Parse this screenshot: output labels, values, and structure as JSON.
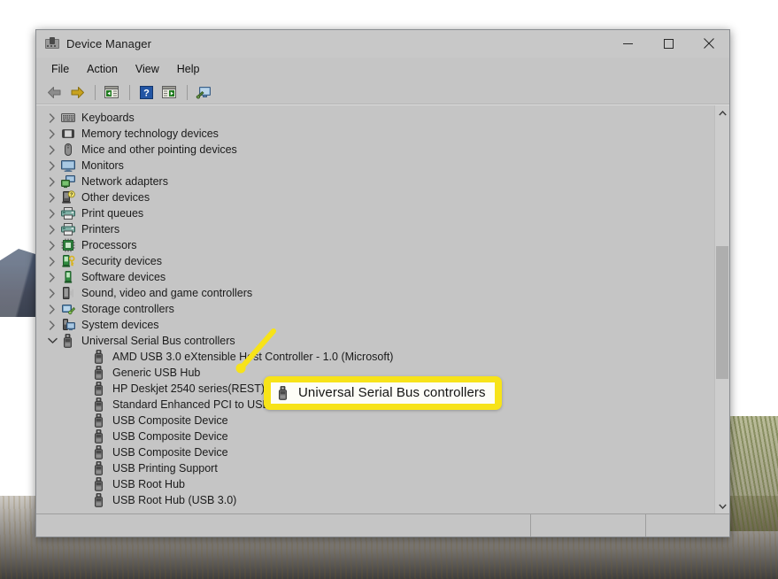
{
  "window": {
    "title": "Device Manager",
    "icon": "device-manager-icon",
    "controls": {
      "minimize": "minimize-button",
      "maximize": "maximize-button",
      "close": "close-button"
    }
  },
  "menubar": {
    "items": [
      {
        "label": "File"
      },
      {
        "label": "Action"
      },
      {
        "label": "View"
      },
      {
        "label": "Help"
      }
    ]
  },
  "toolbar": {
    "items": [
      {
        "name": "back-button",
        "icon": "back-arrow-icon"
      },
      {
        "name": "forward-button",
        "icon": "forward-arrow-icon"
      },
      {
        "name": "separator-1",
        "icon": "separator"
      },
      {
        "name": "show-hide-console-tree-button",
        "icon": "console-tree-icon"
      },
      {
        "name": "separator-2",
        "icon": "separator"
      },
      {
        "name": "help-button",
        "icon": "question-mark-icon"
      },
      {
        "name": "properties-button",
        "icon": "properties-window-icon"
      },
      {
        "name": "separator-3",
        "icon": "separator"
      },
      {
        "name": "scan-for-hardware-changes-button",
        "icon": "monitor-scan-icon"
      }
    ]
  },
  "tree": {
    "items": [
      {
        "label": "Keyboards",
        "icon": "keyboard-icon",
        "expanded": false,
        "level": 0
      },
      {
        "label": "Memory technology devices",
        "icon": "memory-icon",
        "expanded": false,
        "level": 0
      },
      {
        "label": "Mice and other pointing devices",
        "icon": "mouse-icon",
        "expanded": false,
        "level": 0
      },
      {
        "label": "Monitors",
        "icon": "monitor-icon",
        "expanded": false,
        "level": 0
      },
      {
        "label": "Network adapters",
        "icon": "network-adapter-icon",
        "expanded": false,
        "level": 0
      },
      {
        "label": "Other devices",
        "icon": "other-device-icon",
        "expanded": false,
        "level": 0
      },
      {
        "label": "Print queues",
        "icon": "printer-icon",
        "expanded": false,
        "level": 0
      },
      {
        "label": "Printers",
        "icon": "printer-icon",
        "expanded": false,
        "level": 0
      },
      {
        "label": "Processors",
        "icon": "processor-icon",
        "expanded": false,
        "level": 0
      },
      {
        "label": "Security devices",
        "icon": "security-device-icon",
        "expanded": false,
        "level": 0
      },
      {
        "label": "Software devices",
        "icon": "software-device-icon",
        "expanded": false,
        "level": 0
      },
      {
        "label": "Sound, video and game controllers",
        "icon": "sound-device-icon",
        "expanded": false,
        "level": 0
      },
      {
        "label": "Storage controllers",
        "icon": "storage-controller-icon",
        "expanded": false,
        "level": 0
      },
      {
        "label": "System devices",
        "icon": "system-device-icon",
        "expanded": false,
        "level": 0
      },
      {
        "label": "Universal Serial Bus controllers",
        "icon": "usb-icon",
        "expanded": true,
        "level": 0
      },
      {
        "label": "AMD USB 3.0 eXtensible Host Controller - 1.0 (Microsoft)",
        "icon": "usb-icon",
        "level": 1
      },
      {
        "label": "Generic USB Hub",
        "icon": "usb-icon",
        "level": 1
      },
      {
        "label": "HP Deskjet 2540 series(REST)",
        "icon": "usb-icon",
        "level": 1
      },
      {
        "label": "Standard Enhanced PCI to USB Host Controller",
        "icon": "usb-icon",
        "level": 1
      },
      {
        "label": "USB Composite Device",
        "icon": "usb-icon",
        "level": 1
      },
      {
        "label": "USB Composite Device",
        "icon": "usb-icon",
        "level": 1
      },
      {
        "label": "USB Composite Device",
        "icon": "usb-icon",
        "level": 1
      },
      {
        "label": "USB Printing Support",
        "icon": "usb-icon",
        "level": 1
      },
      {
        "label": "USB Root Hub",
        "icon": "usb-icon",
        "level": 1
      },
      {
        "label": "USB Root Hub (USB 3.0)",
        "icon": "usb-icon",
        "level": 1
      }
    ]
  },
  "callout": {
    "text": "Universal Serial Bus controllers",
    "icon": "usb-icon",
    "highlight_color": "#f7e319",
    "inner_color": "#fdfdf7"
  },
  "statusbar": {
    "main": "",
    "pane_b": "",
    "pane_c": ""
  },
  "scrollbar": {
    "up": "scroll-up-arrow",
    "down": "scroll-down-arrow"
  },
  "colors": {
    "window_chrome": "#c5c5c5",
    "text": "#1b1b1b",
    "callout_yellow": "#f7e319"
  }
}
